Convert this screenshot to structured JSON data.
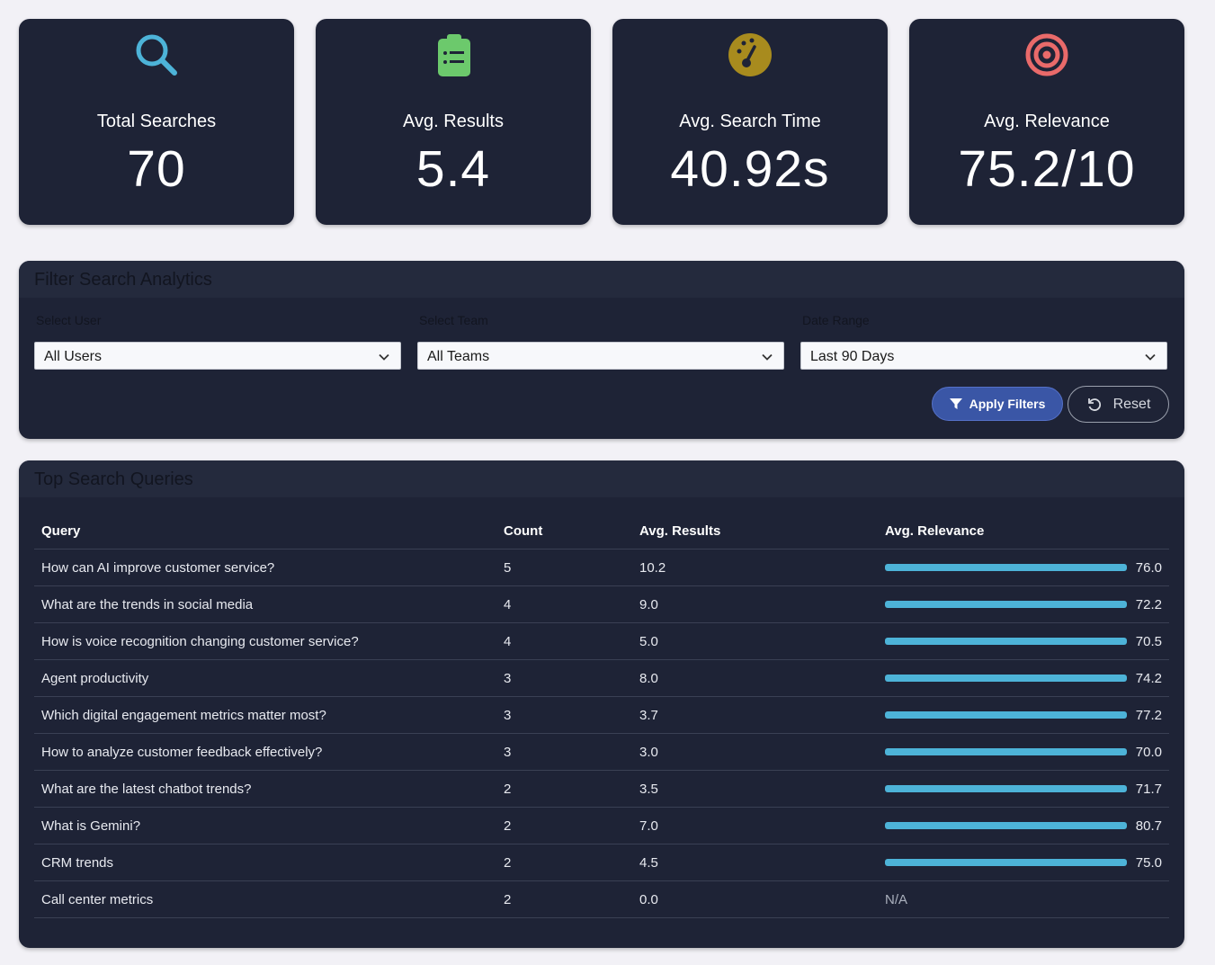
{
  "stats": [
    {
      "title": "Total Searches",
      "value": "70",
      "icon": "search-icon",
      "color": "#4db3d8"
    },
    {
      "title": "Avg. Results",
      "value": "5.4",
      "icon": "clipboard-list-icon",
      "color": "#6cc96c"
    },
    {
      "title": "Avg. Search Time",
      "value": "40.92s",
      "icon": "speedometer-icon",
      "color": "#a88b1e"
    },
    {
      "title": "Avg. Relevance",
      "value": "75.2/10",
      "icon": "target-icon",
      "color": "#e96a6a"
    }
  ],
  "filters": {
    "title": "Filter Search Analytics",
    "user_label": "Select User",
    "team_label": "Select Team",
    "date_label": "Date Range",
    "user_value": "All Users",
    "team_value": "All Teams",
    "date_value": "Last 90 Days",
    "apply_label": "Apply Filters",
    "reset_label": "Reset"
  },
  "queries": {
    "title": "Top Search Queries",
    "columns": [
      "Query",
      "Count",
      "Avg. Results",
      "Avg. Relevance"
    ],
    "rows": [
      {
        "query": "How can AI improve customer service?",
        "count": "5",
        "avg_results": "10.2",
        "relevance": "76.0"
      },
      {
        "query": "What are the trends in social media",
        "count": "4",
        "avg_results": "9.0",
        "relevance": "72.2"
      },
      {
        "query": "How is voice recognition changing customer service?",
        "count": "4",
        "avg_results": "5.0",
        "relevance": "70.5"
      },
      {
        "query": "Agent productivity",
        "count": "3",
        "avg_results": "8.0",
        "relevance": "74.2"
      },
      {
        "query": "Which digital engagement metrics matter most?",
        "count": "3",
        "avg_results": "3.7",
        "relevance": "77.2"
      },
      {
        "query": "How to analyze customer feedback effectively?",
        "count": "3",
        "avg_results": "3.0",
        "relevance": "70.0"
      },
      {
        "query": "What are the latest chatbot trends?",
        "count": "2",
        "avg_results": "3.5",
        "relevance": "71.7"
      },
      {
        "query": "What is Gemini?",
        "count": "2",
        "avg_results": "7.0",
        "relevance": "80.7"
      },
      {
        "query": "CRM trends",
        "count": "2",
        "avg_results": "4.5",
        "relevance": "75.0"
      },
      {
        "query": "Call center metrics",
        "count": "2",
        "avg_results": "0.0",
        "relevance": "N/A"
      }
    ]
  }
}
